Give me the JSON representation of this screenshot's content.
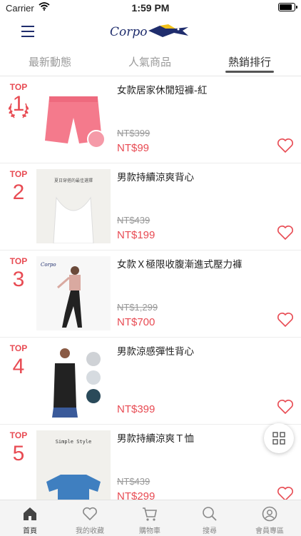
{
  "status_bar": {
    "carrier": "Carrier",
    "time": "1:59 PM"
  },
  "header": {
    "logo_text": "Corpo"
  },
  "tabs": [
    {
      "label": "最新動態",
      "active": false
    },
    {
      "label": "人氣商品",
      "active": false
    },
    {
      "label": "熱銷排行",
      "active": true
    }
  ],
  "rank_prefix": "TOP",
  "items": [
    {
      "rank": "1",
      "name": "女款居家休閒短褲-紅",
      "old_price": "NT$399",
      "price": "NT$99"
    },
    {
      "rank": "2",
      "name": "男款持續涼爽背心",
      "old_price": "NT$439",
      "price": "NT$199",
      "thumb_caption": "夏日穿搭的最佳選擇"
    },
    {
      "rank": "3",
      "name": "女款Ｘ極限收腹漸進式壓力褲",
      "old_price": "NT$1,299",
      "price": "NT$700",
      "thumb_logo": "Corpo"
    },
    {
      "rank": "4",
      "name": "男款涼感彈性背心",
      "old_price": "",
      "price": "NT$399"
    },
    {
      "rank": "5",
      "name": "男款持續涼爽Ｔ恤",
      "old_price": "NT$439",
      "price": "NT$299",
      "thumb_caption": "Simple Style"
    }
  ],
  "bottom_nav": [
    {
      "label": "首頁",
      "icon": "home-icon",
      "active": true
    },
    {
      "label": "我的收藏",
      "icon": "heart-icon",
      "active": false
    },
    {
      "label": "購物車",
      "icon": "cart-icon",
      "active": false
    },
    {
      "label": "搜尋",
      "icon": "search-icon",
      "active": false
    },
    {
      "label": "會員專區",
      "icon": "user-icon",
      "active": false
    }
  ],
  "colors": {
    "accent": "#e84b53",
    "brand_navy": "#1f2d6d",
    "brand_yellow": "#f2c21c"
  }
}
